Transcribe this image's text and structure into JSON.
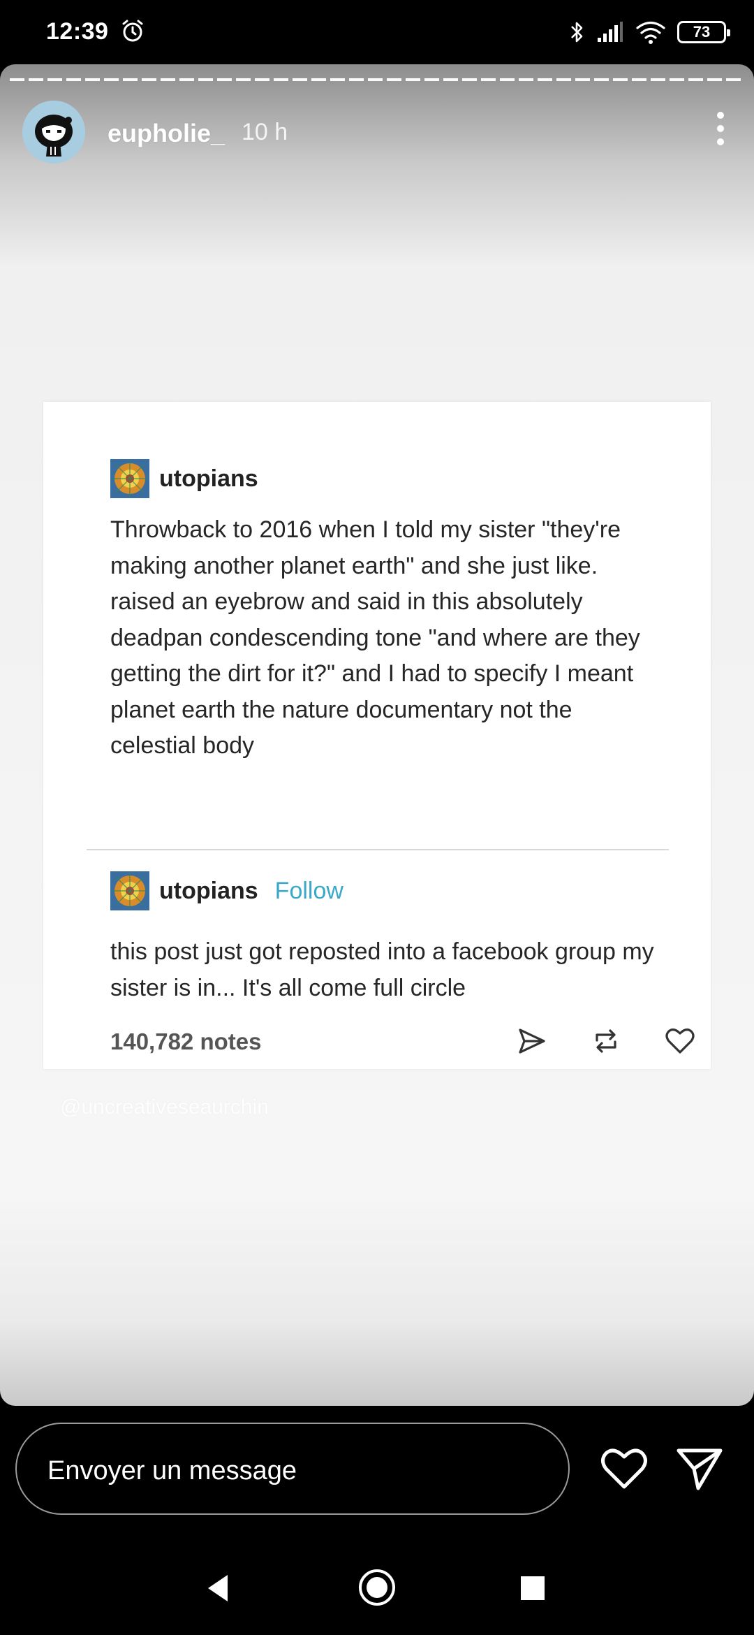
{
  "status_bar": {
    "time": "12:39",
    "battery": "73",
    "icons": [
      "alarm-icon",
      "bluetooth-icon",
      "signal-icon",
      "wifi-icon",
      "battery-icon"
    ]
  },
  "story": {
    "username": "eupholie_",
    "time_ago": "10 h",
    "watermark": "@uncreativeseaurchin",
    "post": {
      "original": {
        "user": "utopians",
        "text": "Throwback to 2016 when I told my sister \"they're making another planet earth\" and she just like. raised an eyebrow and said in this absolutely deadpan condescending tone \"and where are they getting the dirt for it?\" and I had to specify I meant planet earth the nature documentary not the celestial body"
      },
      "reblog": {
        "user": "utopians",
        "follow_label": "Follow",
        "text": "this post just got reposted into a facebook group my sister is in... It's all come full circle"
      },
      "notes": "140,782 notes",
      "actions": [
        "share-icon",
        "reblog-icon",
        "like-icon"
      ]
    }
  },
  "message_bar": {
    "placeholder": "Envoyer un message"
  },
  "colors": {
    "follow": "#3ba7c9",
    "background": "#000000"
  }
}
